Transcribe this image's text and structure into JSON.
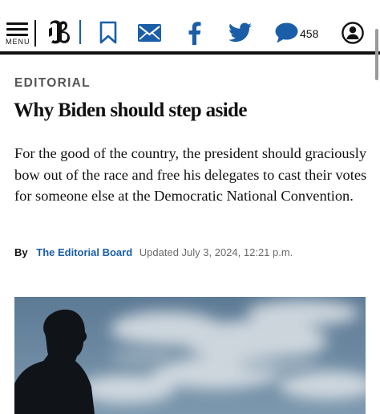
{
  "toolbar": {
    "menu_label": "MENU",
    "logo_letter": "B",
    "comment_count": "458",
    "icons": [
      "menu-icon",
      "boston-globe-logo",
      "bookmark-icon",
      "email-icon",
      "facebook-icon",
      "twitter-icon",
      "comment-icon",
      "account-icon"
    ],
    "colors": {
      "share_blue": "#1b5ea8",
      "text": "#111111"
    }
  },
  "article": {
    "section": "EDITORIAL",
    "headline": "Why Biden should step aside",
    "dek": "For the good of the country, the president should graciously bow out of the race and free his delegates to cast their votes for someone else at the Democratic National Convention.",
    "byline": {
      "prefix": "By",
      "author": "The Editorial Board",
      "updated": "Updated July 3, 2024, 12:21 p.m."
    },
    "colors": {
      "kicker": "#555555",
      "author_link": "#1b5ea8",
      "meta": "#6a6a6a"
    }
  }
}
